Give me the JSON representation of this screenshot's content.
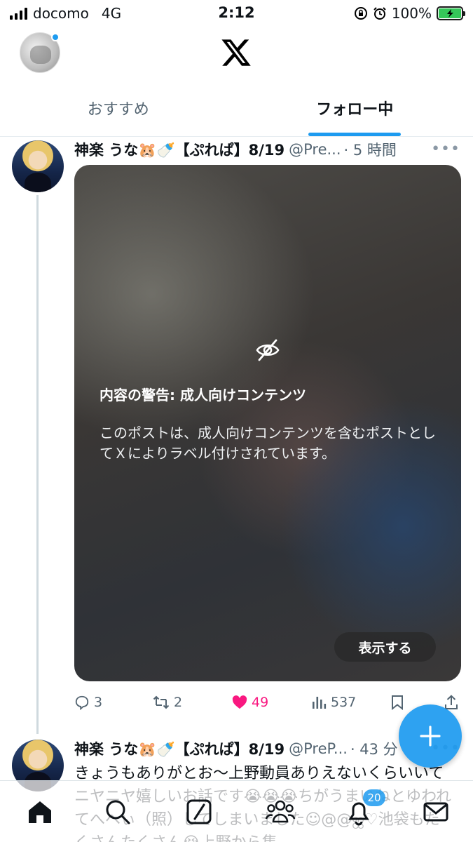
{
  "status_bar": {
    "carrier": "docomo",
    "network": "4G",
    "time": "2:12",
    "battery": "100%"
  },
  "header": {
    "logo": "x-logo",
    "has_notification_dot": true
  },
  "tabs": [
    {
      "label": "おすすめ",
      "active": false
    },
    {
      "label": "フォロー中",
      "active": true
    }
  ],
  "posts": [
    {
      "author": "神楽 うな🐹🍼【ぷれぱ】8/19",
      "handle": "@Pre...",
      "time": "· 5 時間",
      "more": "•••",
      "media_warning": {
        "title": "内容の警告: 成人向けコンテンツ",
        "body": "このポストは、成人向けコンテンツを含むポストとしてＸによりラベル付けされています。",
        "button": "表示する"
      },
      "actions": {
        "replies": "3",
        "reposts": "2",
        "likes": "49",
        "views": "537"
      }
    },
    {
      "author": "神楽 うな🐹🍼【ぷれぱ】8/19",
      "handle": "@PreP...",
      "time": "· 43 分",
      "more": "•••",
      "text": "きょうもありがとお〜上野動員ありえないくらいいてニヤニヤ嬉しいお話です😭😭😭ちがうまいねとゆわれてへへぃ（照）してしまいました☺︎@@ஐ♡池袋もたくさんたくさん😭上野から集"
    }
  ],
  "bottom_nav": {
    "notifications_badge": "20"
  },
  "colors": {
    "accent": "#1d9bf0",
    "like": "#f91880",
    "text": "#0f1419",
    "secondary": "#536471"
  }
}
